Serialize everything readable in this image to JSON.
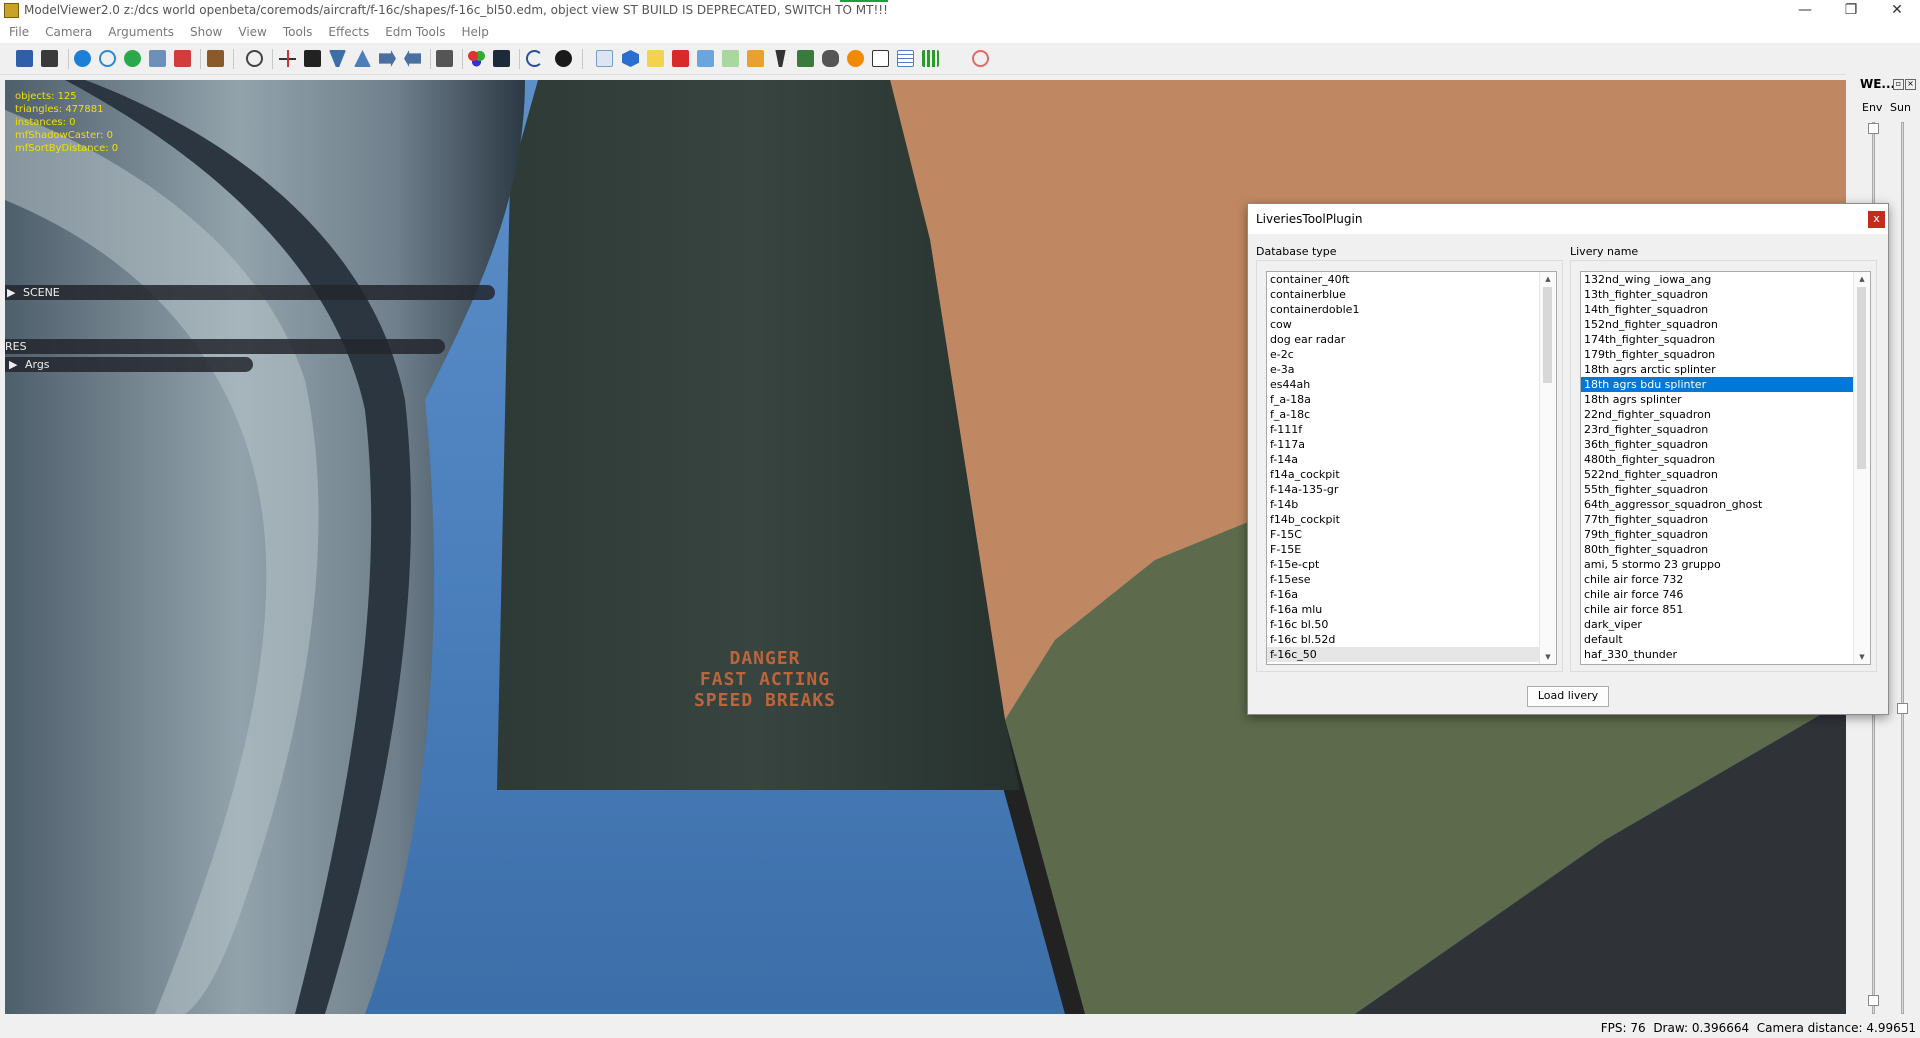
{
  "window": {
    "title": "ModelViewer2.0 z:/dcs world openbeta/coremods/aircraft/f-16c/shapes/f-16c_bl50.edm, object view ST BUILD IS DEPRECATED, SWITCH TO MT!!!",
    "controls": {
      "minimize": "—",
      "restore": "❐",
      "close": "✕"
    }
  },
  "menu": [
    "File",
    "Camera",
    "Arguments",
    "Show",
    "View",
    "Tools",
    "Effects",
    "Edm Tools",
    "Help"
  ],
  "stats": [
    "objects: 125",
    "triangles: 477881",
    "instances: 0",
    "mfShadowCaster: 0",
    "mfSortByDistance: 0"
  ],
  "tree": {
    "scene": "SCENE",
    "res": "RES",
    "args": "Args"
  },
  "stencil": [
    "DANGER",
    "FAST ACTING",
    "SPEED BREAKS"
  ],
  "we_panel": {
    "title": "WE...",
    "env": "Env",
    "sun": "Sun"
  },
  "status": {
    "fps": "FPS: 76",
    "draw": "Draw: 0.396664",
    "camera": "Camera distance: 4.99651"
  },
  "dialog": {
    "title": "LiveriesToolPlugin",
    "close": "x",
    "database_label": "Database type",
    "livery_label": "Livery name",
    "load_button": "Load livery",
    "database_items": [
      "container_40ft",
      "containerblue",
      "containerdoble1",
      "cow",
      "dog ear radar",
      "e-2c",
      "e-3a",
      "es44ah",
      "f_a-18a",
      "f_a-18c",
      "f-111f",
      "f-117a",
      "f-14a",
      "f14a_cockpit",
      "f-14a-135-gr",
      "f-14b",
      "f14b_cockpit",
      "F-15C",
      "F-15E",
      "f-15e-cpt",
      "f-15ese",
      "f-16a",
      "f-16a mlu",
      "f-16c bl.50",
      "f-16c bl.52d",
      "f-16c_50"
    ],
    "database_current": "f-16c_50",
    "livery_items": [
      "132nd_wing _iowa_ang",
      "13th_fighter_squadron",
      "14th_fighter_squadron",
      "152nd_fighter_squadron",
      "174th_fighter_squadron",
      "179th_fighter_squadron",
      "18th agrs arctic splinter",
      "18th agrs bdu splinter",
      "18th agrs splinter",
      "22nd_fighter_squadron",
      "23rd_fighter_squadron",
      "36th_fighter_squadron",
      "480th_fighter_squadron",
      "522nd_fighter_squadron",
      "55th_fighter_squadron",
      "64th_aggressor_squadron_ghost",
      "77th_fighter_squadron",
      "79th_fighter_squadron",
      "80th_fighter_squadron",
      "ami, 5 stormo 23 gruppo",
      "chile air force 732",
      "chile air force 746",
      "chile air force 851",
      "dark_viper",
      "default",
      "haf_330_thunder"
    ],
    "livery_selected": "18th agrs bdu splinter"
  },
  "colors": {
    "selection": "#0078d7",
    "stats_text": "#f0e000",
    "sky": "#4a7fbc",
    "close_red": "#c42b1c"
  }
}
